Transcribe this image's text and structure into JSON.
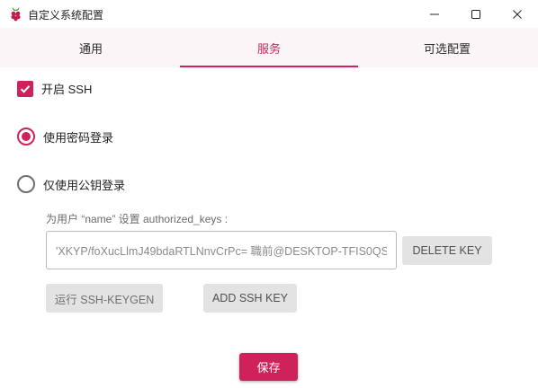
{
  "window": {
    "title": "自定义系统配置",
    "app_icon": "raspberry-icon",
    "controls": [
      "minimize-icon",
      "maximize-icon",
      "close-icon"
    ]
  },
  "tabs": [
    {
      "label": "通用",
      "active": false
    },
    {
      "label": "服务",
      "active": true
    },
    {
      "label": "可选配置",
      "active": false
    }
  ],
  "services": {
    "enable_ssh": {
      "label": "开启 SSH",
      "checked": true
    },
    "auth_password": {
      "label": "使用密码登录",
      "selected": true
    },
    "auth_pubkey": {
      "label": "仅使用公钥登录",
      "selected": false
    },
    "authorized_keys_label": "为用户 “name” 设置 authorized_keys :",
    "authorized_key_value": "'XKYP/foXucLlmJ49bdaRTLNnvCrPc= 職前@DESKTOP-TFIS0QS",
    "delete_key_label": "DELETE KEY",
    "keygen_label": "运行 SSH-KEYGEN",
    "add_key_label": "ADD SSH KEY"
  },
  "save_label": "保存",
  "colors": {
    "accent": "#d0225a",
    "tab_bar_bg": "#fcf5f8",
    "disabled_button_bg": "#e3e3e3"
  }
}
